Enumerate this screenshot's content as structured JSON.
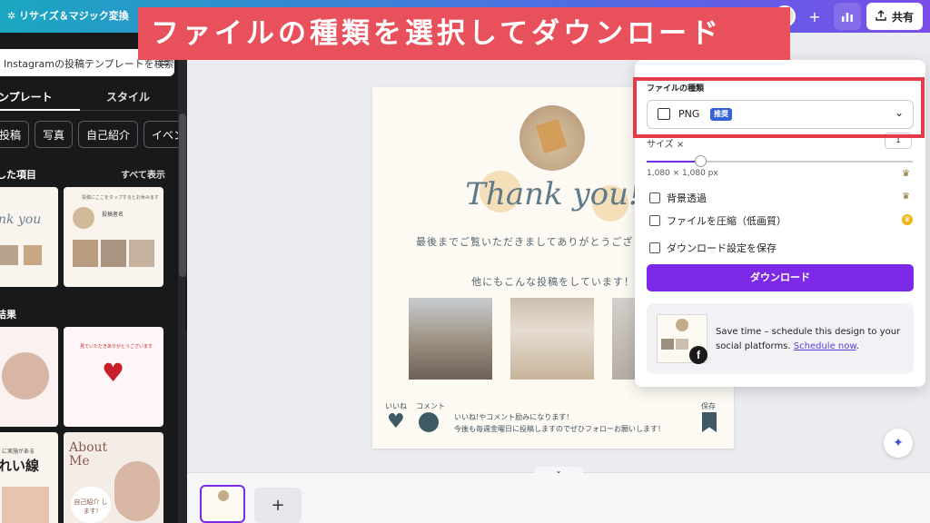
{
  "topbar": {
    "resize_label": "✲ リサイズ＆マジック変換",
    "add_icon": "plus-icon",
    "stats_icon": "bar-chart-icon",
    "share_label": "共有",
    "share_icon": "upload-icon"
  },
  "banner": {
    "title": "ファイルの種類を選択してダウンロード"
  },
  "left_panel": {
    "search_placeholder": "Instagramの投稿テンプレートを検索",
    "tabs": [
      {
        "label": "ンプレート",
        "active": true
      },
      {
        "label": "スタイル",
        "active": false
      }
    ],
    "chips": [
      "投稿",
      "写真",
      "自己紹介",
      "イベン"
    ],
    "recent_title": "した項目",
    "see_all_label": "すべて表示",
    "results_title": "結果",
    "thumbs": {
      "t1_text": "nk you",
      "t2_title": "投稿にここをタップするとお休みます",
      "t2_name": "投稿者名",
      "t3_title": "見ていただきありがとうございます",
      "t4_text": "れい線",
      "t4_sub": "に実施がある",
      "t5_title": "About Me",
      "t5_badge": "自己紹介 します!"
    }
  },
  "design": {
    "thanks_script": "Thank you!",
    "line1": "最後までご覧いただきましてありがとうござ",
    "line2": "他にもこんな投稿をしています！",
    "label_like": "いいね",
    "label_comment": "コメント",
    "label_save": "保存",
    "message1": "いいね!やコメント励みになります！",
    "message2": "今後も毎週金曜日に投稿しますのでぜひフォローお願いします！"
  },
  "download_panel": {
    "file_type_label": "ファイルの種類",
    "file_type_value": "PNG",
    "recommended_badge": "推奨",
    "size_label": "サイズ ×",
    "size_value": "1",
    "size_fraction": 0.2,
    "dimensions": "1,080 × 1,080 px",
    "options": [
      {
        "label": "背景透過",
        "checked": false,
        "badge": "crown"
      },
      {
        "label": "ファイルを圧縮（低画質）",
        "checked": false,
        "badge": "coin"
      },
      {
        "label": "ダウンロード設定を保存",
        "checked": false,
        "badge": ""
      }
    ],
    "download_button": "ダウンロード",
    "promo_text": "Save time – schedule this design to your social platforms.",
    "promo_link": "Schedule now",
    "promo_end": "."
  },
  "bottom": {
    "add_page_symbol": "+",
    "hide_pages_icon": "chevron-down-icon"
  },
  "colors": {
    "accent": "#7d2ae8",
    "highlight": "#e53b48",
    "banner": "#e8505b",
    "badge": "#3460d9",
    "design_ink": "#3f5a64"
  }
}
